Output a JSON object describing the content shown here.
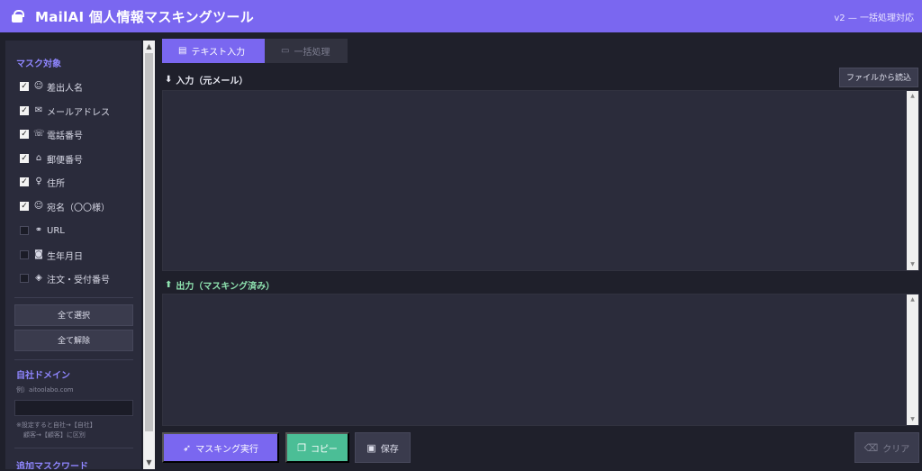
{
  "header": {
    "title": "MailAI 個人情報マスキングツール",
    "version": "v2 — 一括処理対応"
  },
  "sidebar": {
    "mask_title": "マスク対象",
    "items": [
      {
        "label": "差出人名",
        "checked": true,
        "icon": "person-icon"
      },
      {
        "label": "メールアドレス",
        "checked": true,
        "icon": "mail-icon"
      },
      {
        "label": "電話番号",
        "checked": true,
        "icon": "phone-icon"
      },
      {
        "label": "郵便番号",
        "checked": true,
        "icon": "post-office-icon"
      },
      {
        "label": "住所",
        "checked": true,
        "icon": "pin-icon"
      },
      {
        "label": "宛名（〇〇様）",
        "checked": true,
        "icon": "person-icon"
      },
      {
        "label": "URL",
        "checked": false,
        "icon": "link-icon"
      },
      {
        "label": "生年月日",
        "checked": false,
        "icon": "cake-icon"
      },
      {
        "label": "注文・受付番号",
        "checked": false,
        "icon": "ticket-icon"
      }
    ],
    "select_all": "全て選択",
    "clear_all": "全て解除",
    "domain_title": "自社ドメイン",
    "domain_placeholder": "例）aitoolabo.com",
    "domain_hint_1": "※設定すると自社→【自社】",
    "domain_hint_2": "顧客→【顧客】に区別",
    "keyword_title": "追加マスクワード"
  },
  "tabs": [
    {
      "label": "テキスト入力",
      "active": true
    },
    {
      "label": "一括処理",
      "active": false
    }
  ],
  "input": {
    "label": "入力（元メール）",
    "file_button": "ファイルから読込",
    "value": ""
  },
  "output": {
    "label": "出力（マスキング済み）",
    "value": ""
  },
  "actions": {
    "run": "マスキング実行",
    "copy": "コピー",
    "save": "保存",
    "clear": "クリア"
  },
  "colors": {
    "accent": "#7a67f0",
    "copy": "#4bbe96",
    "output_label": "#8fe3b0"
  }
}
